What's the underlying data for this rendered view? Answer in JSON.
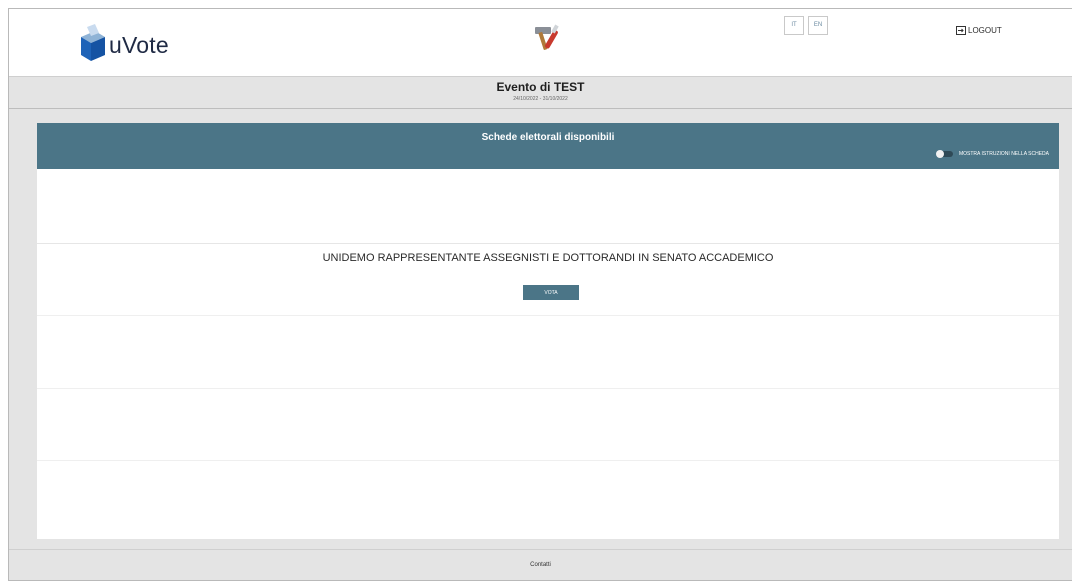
{
  "header": {
    "logo_text": "uVote",
    "languages": [
      "IT",
      "EN"
    ],
    "logout_label": "LOGOUT"
  },
  "event": {
    "title": "Evento di TEST",
    "dates": "24/10/2022 - 31/10/2022"
  },
  "ballots": {
    "title": "Schede elettorali disponibili",
    "toggle_label": "MOSTRA ISTRUZIONI NELLA SCHEDA",
    "items": [
      {
        "name": "UNIDEMO RAPPRESENTANTE ASSEGNISTI E DOTTORANDI IN SENATO ACCADEMICO",
        "action": "VOTA"
      }
    ]
  },
  "footer": {
    "link": "Contatti"
  },
  "colors": {
    "accent": "#4b7587",
    "background": "#e4e4e4"
  }
}
